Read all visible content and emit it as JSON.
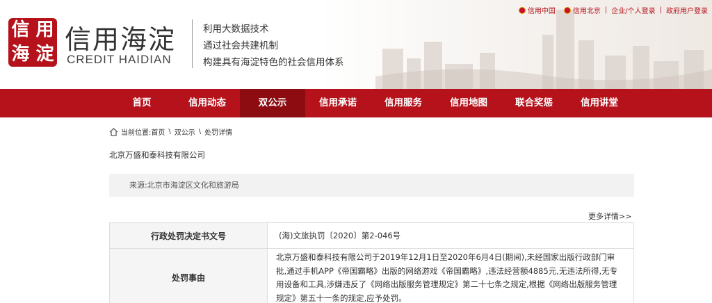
{
  "header": {
    "logo_seal_chars": [
      "信",
      "用",
      "海",
      "淀"
    ],
    "logo_cn": "信用海淀",
    "logo_en": "CREDIT  HAIDIAN",
    "slogans": [
      "利用大数据技术",
      "通过社会共建机制",
      "构建具有海淀特色的社会信用体系"
    ],
    "top_links": [
      "信用中国",
      "信用北京",
      "企业/个人登录",
      "政府用户登录"
    ]
  },
  "nav": {
    "items": [
      "首页",
      "信用动态",
      "双公示",
      "信用承诺",
      "信用服务",
      "信用地图",
      "联合奖惩",
      "信用讲堂"
    ],
    "active_index": 2
  },
  "breadcrumb": {
    "prefix": "当前位置:",
    "items": [
      "首页",
      "双公示",
      "处罚详情"
    ],
    "separator": "\\"
  },
  "company_name": "北京万盛和泰科技有限公司",
  "source": "来源:北京市海淀区文化和旅游局",
  "more_link": "更多详情>>",
  "table": {
    "rows": [
      {
        "label": "行政处罚决定书文号",
        "value": "(海)文旅执罚〔2020〕第2-046号"
      },
      {
        "label": "处罚事由",
        "value": "北京万盛和泰科技有限公司于2019年12月1日至2020年6月4日(期间),未经国家出版行政部门审批,通过手机APP《帝国霸略》出版的网络游戏《帝国霸略》,违法经营额4885元,无违法所得,无专用设备和工具,涉嫌违反了《网络出版服务管理规定》第二十七条之规定,根据《网络出版服务管理规定》第五十一条的规定,应予处罚。"
      }
    ]
  },
  "colors": {
    "brand_red": "#b5121b",
    "nav_active": "#8c0c12",
    "source_bg": "#f2f2f2"
  }
}
